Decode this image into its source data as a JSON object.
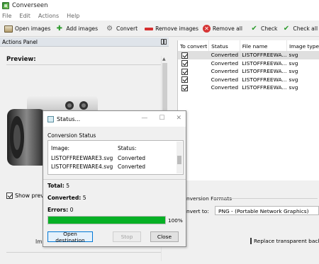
{
  "window": {
    "title": "Converseen"
  },
  "menu": [
    "File",
    "Edit",
    "Actions",
    "Help"
  ],
  "toolbar": {
    "open_images": "Open images",
    "add_images": "Add images",
    "convert": "Convert",
    "remove_images": "Remove images",
    "remove_all": "Remove all",
    "check": "Check",
    "check_all": "Check all"
  },
  "actions_panel": {
    "title": "Actions Panel",
    "preview_label": "Preview:",
    "show_preview_label": "Show previe",
    "truncated_label": "Im"
  },
  "file_table": {
    "headers": [
      "To convert",
      "Status",
      "File name",
      "Image type"
    ],
    "rows": [
      {
        "checked": true,
        "status": "Converted",
        "file": "LISTOFFREEWA...",
        "type": "svg"
      },
      {
        "checked": true,
        "status": "Converted",
        "file": "LISTOFFREEWA...",
        "type": "svg"
      },
      {
        "checked": true,
        "status": "Converted",
        "file": "LISTOFFREEWA...",
        "type": "svg"
      },
      {
        "checked": true,
        "status": "Converted",
        "file": "LISTOFFREEWA...",
        "type": "svg"
      },
      {
        "checked": true,
        "status": "Converted",
        "file": "LISTOFFREEWA...",
        "type": "svg"
      }
    ]
  },
  "conversion": {
    "section_label": "nversion Formats",
    "convert_to_label": "nvert to:",
    "convert_to_value": "PNG - (Portable Network Graphics)",
    "replace_transparent_label": "Replace transparent backg"
  },
  "status_dialog": {
    "title": "Status...",
    "section": "Conversion Status",
    "image_header": "Image:",
    "status_header": "Status:",
    "rows": [
      {
        "image": "LISTOFFREEWARE3.svg",
        "status": "Converted"
      },
      {
        "image": "LISTOFFREEWARE4.svg",
        "status": "Converted"
      }
    ],
    "total_label": "Total:",
    "total_value": "5",
    "converted_label": "Converted:",
    "converted_value": "5",
    "errors_label": "Errors:",
    "errors_value": "0",
    "progress_percent": 100,
    "progress_text": "100%",
    "open_destination": "Open destination",
    "stop": "Stop",
    "close": "Close"
  },
  "colors": {
    "progress": "#06b025",
    "accent": "#0078d7"
  }
}
